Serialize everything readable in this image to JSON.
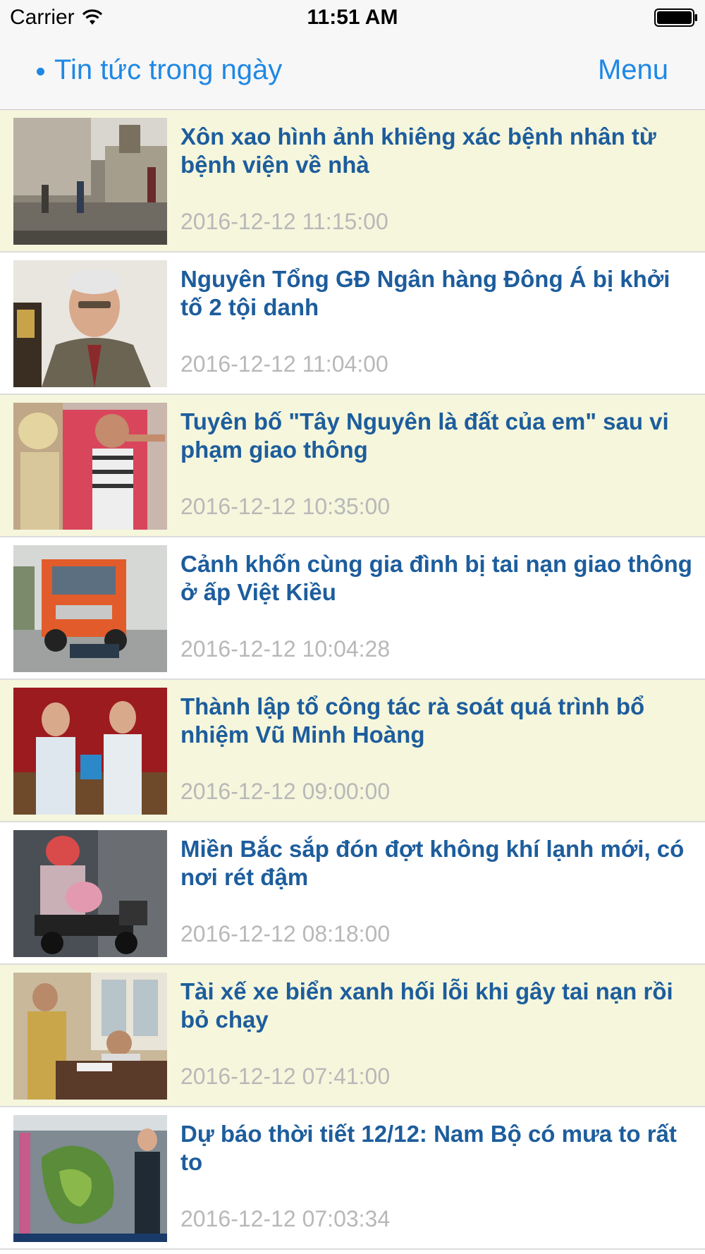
{
  "status_bar": {
    "carrier": "Carrier",
    "time": "11:51 AM"
  },
  "nav": {
    "title": "Tin tức trong ngày",
    "menu_label": "Menu",
    "accent_color": "#1e88e5"
  },
  "news": [
    {
      "title": "Xôn xao hình ảnh khiêng xác bệnh nhân từ bệnh viện về nhà",
      "time": "2016-12-12 11:15:00"
    },
    {
      "title": "Nguyên Tổng GĐ Ngân hàng Đông Á bị khởi tố 2 tội danh",
      "time": "2016-12-12 11:04:00"
    },
    {
      "title": "Tuyên bố \"Tây Nguyên là đất của em\" sau vi phạm giao thông",
      "time": "2016-12-12 10:35:00"
    },
    {
      "title": "Cảnh khốn cùng gia đình bị tai nạn giao thông ở ấp Việt Kiều",
      "time": "2016-12-12 10:04:28"
    },
    {
      "title": "Thành lập tổ công tác rà soát quá trình bổ nhiệm Vũ Minh Hoàng",
      "time": "2016-12-12 09:00:00"
    },
    {
      "title": "Miền Bắc sắp đón đợt không khí lạnh mới, có nơi rét đậm",
      "time": "2016-12-12 08:18:00"
    },
    {
      "title": "Tài xế xe biển xanh hối lỗi khi gây tai nạn rồi bỏ chạy",
      "time": "2016-12-12 07:41:00"
    },
    {
      "title": "Dự báo thời tiết 12/12: Nam Bộ có mưa to rất to",
      "time": "2016-12-12 07:03:34"
    }
  ]
}
